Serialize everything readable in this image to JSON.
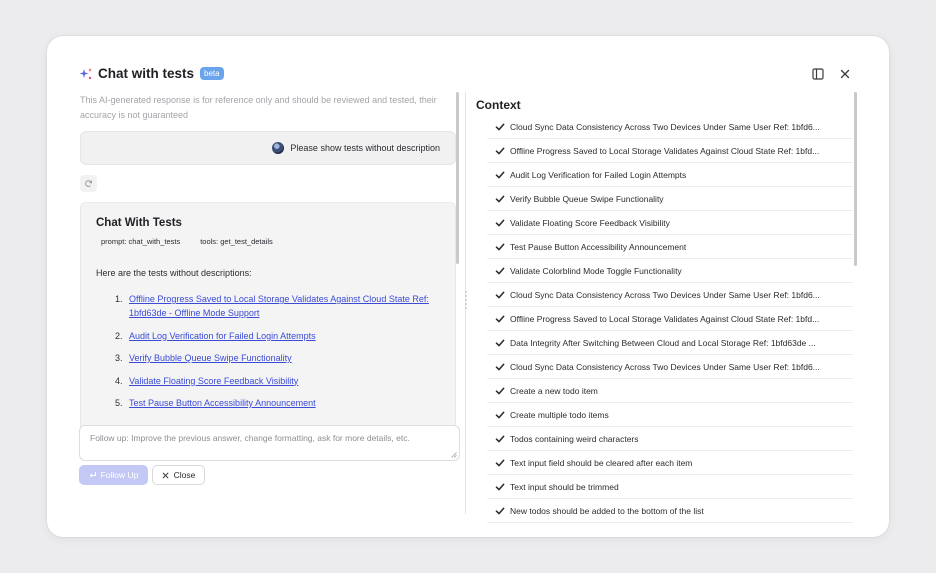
{
  "header": {
    "title": "Chat with tests",
    "badge": "beta"
  },
  "disclaimer": "This AI-generated response is for reference only and should be reviewed and tested, their accuracy is not guaranteed",
  "user_message": "Please show tests without description",
  "answer": {
    "title": "Chat With Tests",
    "prompt": "prompt: chat_with_tests",
    "tools": "tools: get_test_details",
    "intro": "Here are the tests without descriptions:",
    "items": [
      {
        "num": "1.",
        "text": "Offline Progress Saved to Local Storage Validates Against Cloud State Ref: 1bfd63de - Offline Mode Support"
      },
      {
        "num": "2.",
        "text": "Audit Log Verification for Failed Login Attempts"
      },
      {
        "num": "3.",
        "text": "Verify Bubble Queue Swipe Functionality"
      },
      {
        "num": "4.",
        "text": "Validate Floating Score Feedback Visibility"
      },
      {
        "num": "5.",
        "text": "Test Pause Button Accessibility Announcement"
      }
    ]
  },
  "followup": {
    "placeholder": "Follow up: Improve the previous answer, change formatting, ask for more details, etc."
  },
  "buttons": {
    "follow_up": "Follow Up",
    "close": "Close"
  },
  "context": {
    "title": "Context",
    "items": [
      "Cloud Sync Data Consistency Across Two Devices Under Same User Ref: 1bfd6...",
      "Offline Progress Saved to Local Storage Validates Against Cloud State Ref: 1bfd...",
      "Audit Log Verification for Failed Login Attempts",
      "Verify Bubble Queue Swipe Functionality",
      "Validate Floating Score Feedback Visibility",
      "Test Pause Button Accessibility Announcement",
      "Validate Colorblind Mode Toggle Functionality",
      "Cloud Sync Data Consistency Across Two Devices Under Same User Ref: 1bfd6...",
      "Offline Progress Saved to Local Storage Validates Against Cloud State Ref: 1bfd...",
      "Data Integrity After Switching Between Cloud and Local Storage Ref: 1bfd63de ...",
      "Cloud Sync Data Consistency Across Two Devices Under Same User Ref: 1bfd6...",
      "Create a new todo item",
      "Create multiple todo items",
      "Todos containing weird characters",
      "Text input field should be cleared after each item",
      "Text input should be trimmed",
      "New todos should be added to the bottom of the list"
    ]
  },
  "icons": {
    "sparkle": "sparkle-icon",
    "panel": "sidebar-panel-icon",
    "close": "close-icon",
    "refresh": "refresh-icon",
    "check": "check-icon",
    "enter": "enter-icon"
  },
  "colors": {
    "accent": "#3b4bd6",
    "badge": "#6aa4ec",
    "follow_button": "#c4c8f5"
  }
}
